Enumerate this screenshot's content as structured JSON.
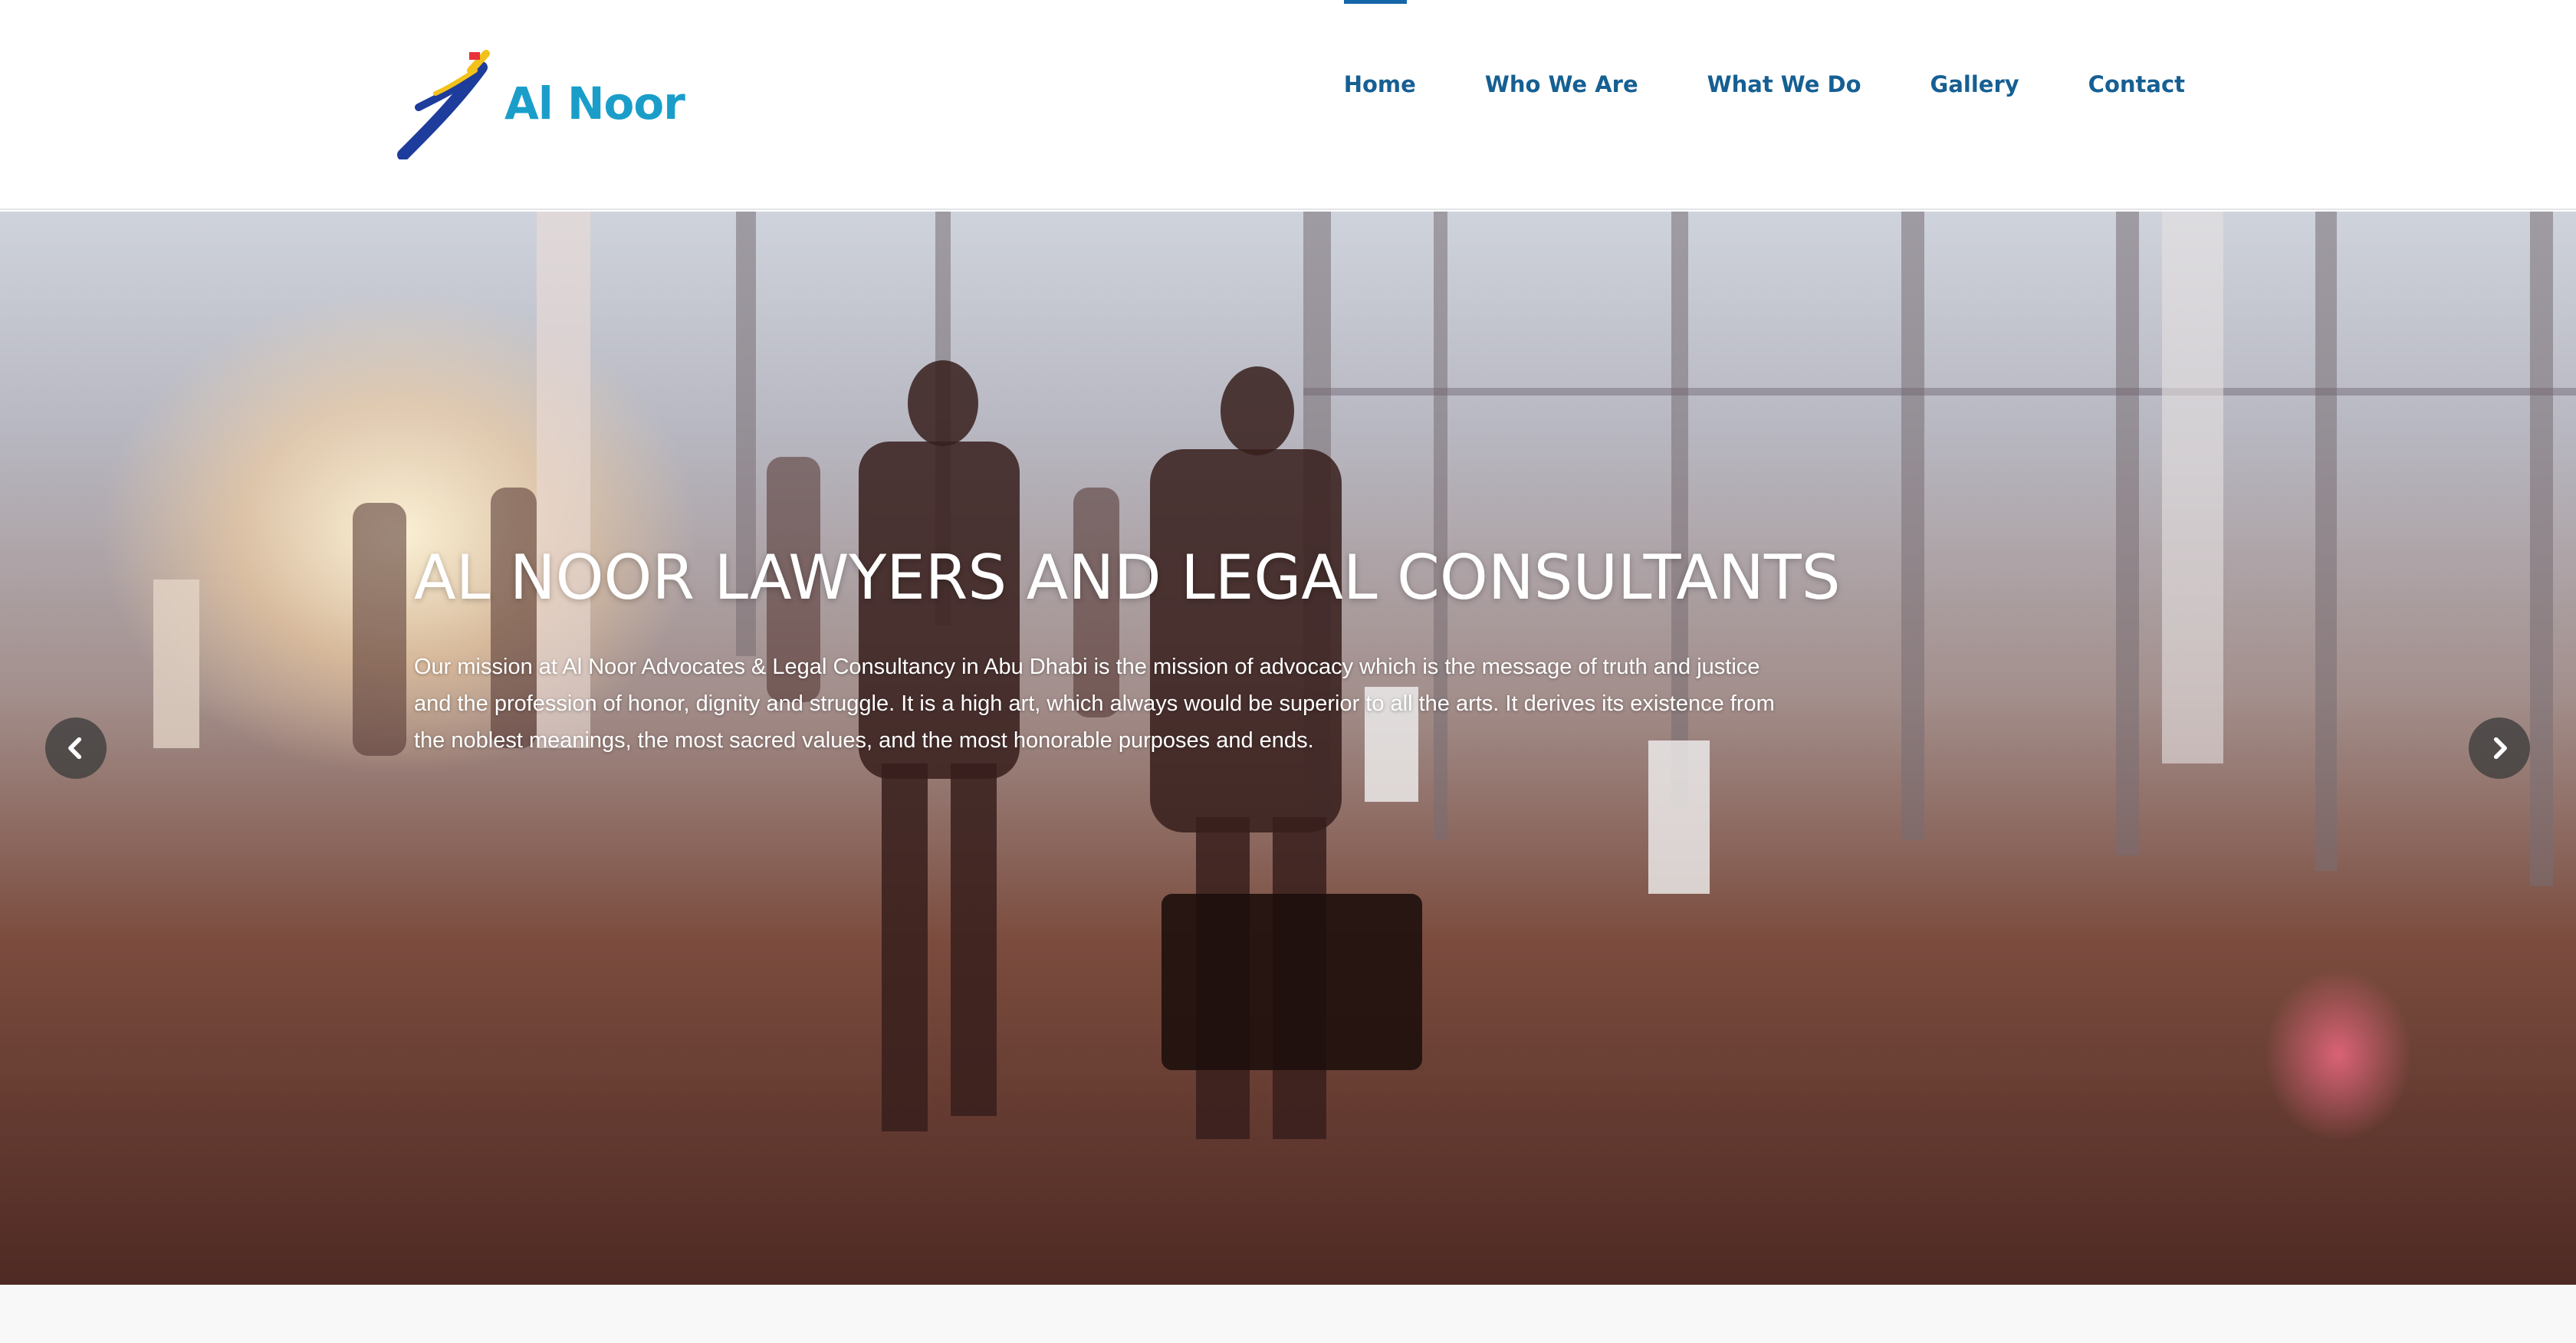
{
  "brand": {
    "name": "Al Noor",
    "colors": {
      "text": "#1a9ec9",
      "swoosh_dark": "#1d3c9b",
      "swoosh_light": "#f2c21a"
    }
  },
  "nav": {
    "active": "Home",
    "items": [
      {
        "label": "Home"
      },
      {
        "label": "Who We Are"
      },
      {
        "label": "What We Do"
      },
      {
        "label": "Gallery"
      },
      {
        "label": "Contact"
      }
    ]
  },
  "hero": {
    "title": "AL NOOR LAWYERS AND LEGAL CONSULTANTS",
    "text": "Our mission at Al Noor Advocates & Legal Consultancy in Abu Dhabi is the mission of advocacy which is the message of truth and justice and the profession of honor, dignity and struggle. It is a high art, which always would be superior to all the arts. It derives its existence from the noblest meanings, the most sacred values, and the most honorable purposes and ends.",
    "prev_icon": "chevron-left-icon",
    "next_icon": "chevron-right-icon"
  },
  "theme": {
    "nav_color": "#165f93",
    "active_indicator": "#1466a8"
  }
}
